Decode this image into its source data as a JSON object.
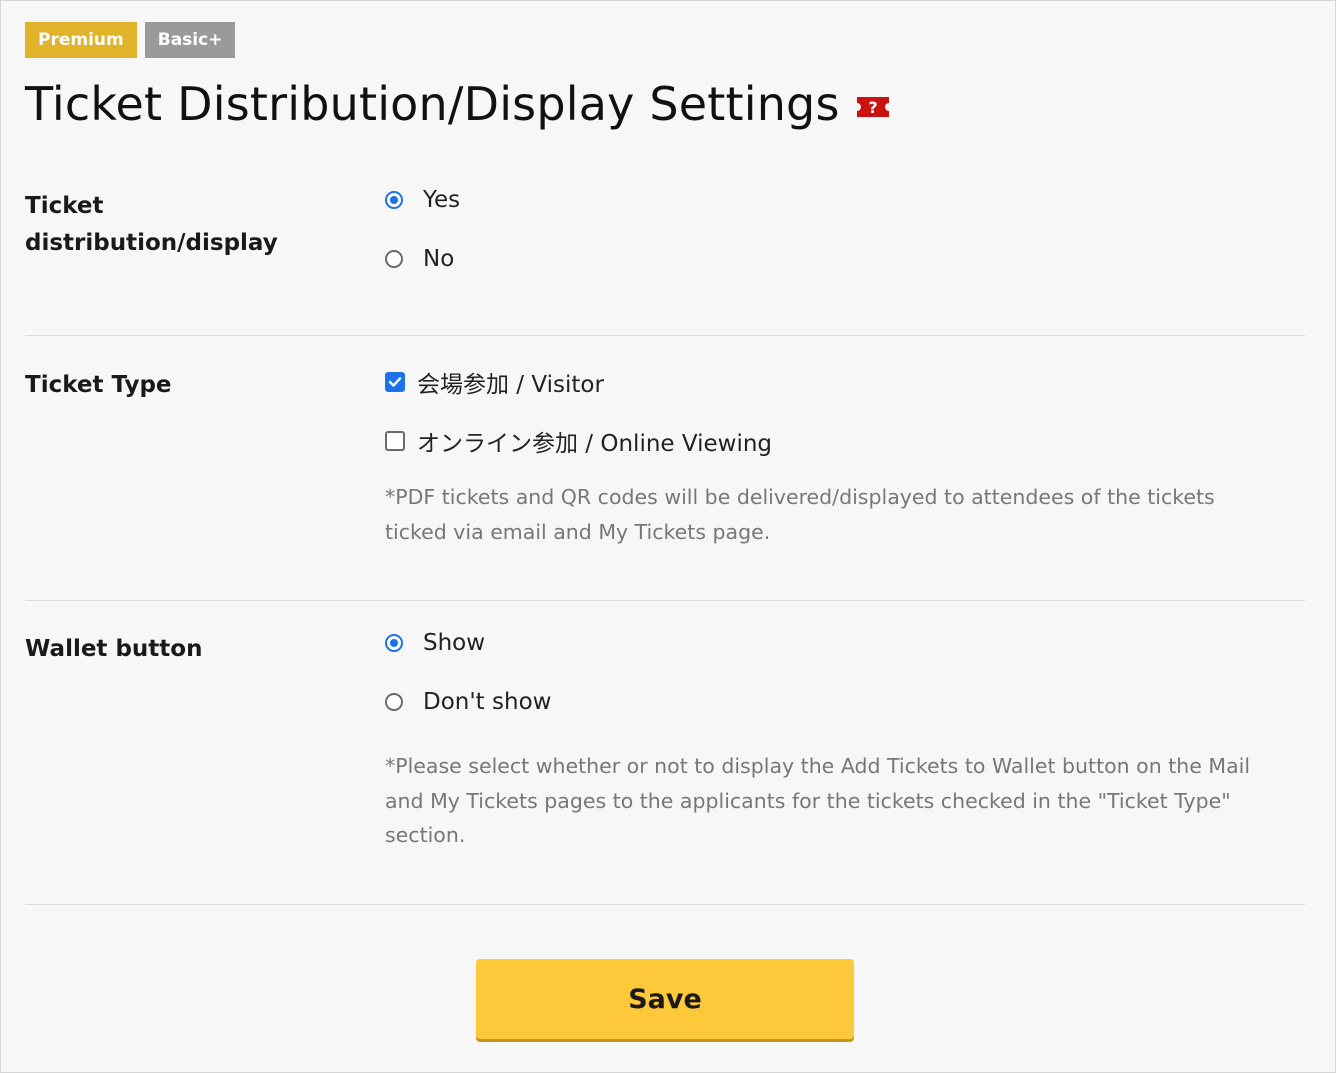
{
  "badges": {
    "premium": "Premium",
    "basic": "Basic+"
  },
  "page": {
    "title": "Ticket Distribution/Display Settings",
    "help_icon_glyph": "?"
  },
  "distribution": {
    "label_line1": "Ticket",
    "label_line2": "distribution/display",
    "options": [
      {
        "label": "Yes",
        "checked": true
      },
      {
        "label": "No",
        "checked": false
      }
    ]
  },
  "ticket_type": {
    "label": "Ticket Type",
    "options": [
      {
        "label": "会場参加 / Visitor",
        "checked": true
      },
      {
        "label": "オンライン参加 / Online Viewing",
        "checked": false
      }
    ],
    "note": "*PDF tickets and QR codes will be delivered/displayed to attendees of the tickets ticked via email and My Tickets page."
  },
  "wallet": {
    "label": "Wallet button",
    "options": [
      {
        "label": "Show",
        "checked": true
      },
      {
        "label": "Don't show",
        "checked": false
      }
    ],
    "note": "*Please select whether or not to display the Add Tickets to Wallet button on the Mail and My Tickets pages to the applicants for the tickets checked in the \"Ticket Type\" section."
  },
  "actions": {
    "save_label": "Save"
  },
  "colors": {
    "premium_badge": "#e0b32a",
    "basic_badge": "#9a9a9a",
    "accent_blue": "#1a73e8",
    "save_button": "#fdc93b",
    "help_icon": "#cc1111"
  }
}
